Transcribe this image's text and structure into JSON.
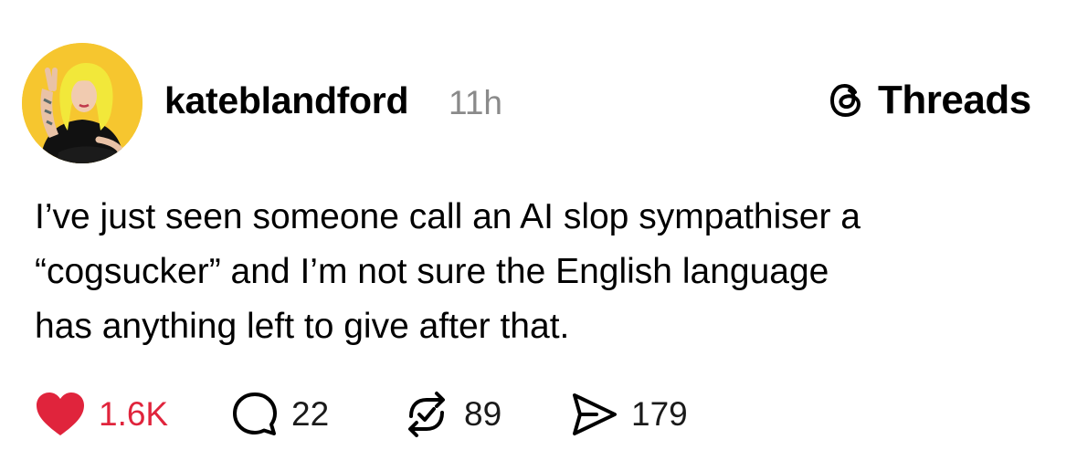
{
  "post": {
    "username": "kateblandford",
    "time": "11h",
    "text": "I’ve just seen someone call an AI slop sympathiser a\n“cogsucker” and I’m not sure the English language\nhas anything left to give after that.",
    "avatar_bg_color": "#f6c62f",
    "hair_color": "#f2e83a"
  },
  "brand": {
    "icon": "threads-logo-icon",
    "label": "Threads"
  },
  "actions": {
    "like": {
      "icon": "heart-icon",
      "count": "1.6K",
      "liked": true,
      "color": "#e0243c"
    },
    "reply": {
      "icon": "comment-icon",
      "count": "22"
    },
    "repost": {
      "icon": "repost-icon",
      "count": "89"
    },
    "share": {
      "icon": "send-icon",
      "count": "179"
    }
  }
}
